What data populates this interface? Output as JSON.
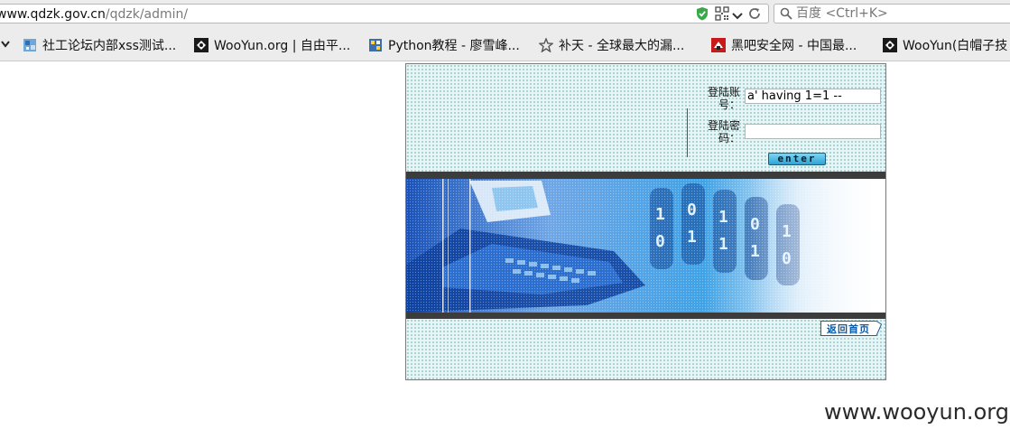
{
  "browser": {
    "url_host": "www.qdzk.gov.cn",
    "url_path": "/qdzk/admin/",
    "search_placeholder": "百度 <Ctrl+K>",
    "bookmarks": [
      {
        "label": "社工论坛内部xss测试...",
        "icon": "globe-icon"
      },
      {
        "label": "WooYun.org | 自由平...",
        "icon": "wooyun-icon"
      },
      {
        "label": "Python教程 - 廖雪峰...",
        "icon": "python-icon"
      },
      {
        "label": "补天 - 全球最大的漏...",
        "icon": "star-icon"
      },
      {
        "label": "黑吧安全网 - 中国最...",
        "icon": "hackbar-icon"
      },
      {
        "label": "WooYun(白帽子技",
        "icon": "wooyun-icon"
      }
    ]
  },
  "login": {
    "username_label_1": "登陆账",
    "username_label_2": "号：",
    "username_value": "a' having 1=1 --",
    "password_label_1": "登陆密",
    "password_label_2": "码：",
    "password_value": "",
    "enter_label": "enter"
  },
  "footer": {
    "home_link": "返回首页"
  },
  "watermark": "www.wooyun.org",
  "colors": {
    "panel_bg": "#e6f6f6",
    "band": "#3c3c3c",
    "button": "#2aa4d6",
    "link": "#0b5aa6"
  }
}
